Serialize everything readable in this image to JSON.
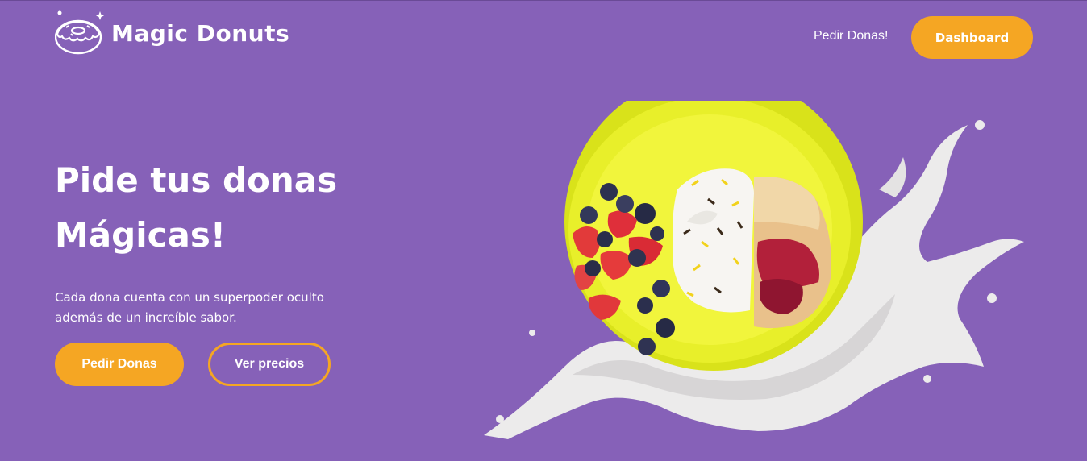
{
  "header": {
    "brand_name": "Magic Donuts",
    "logo_icon": "donut-logo-icon",
    "nav_link_label": "Pedir Donas!",
    "dashboard_label": "Dashboard"
  },
  "hero": {
    "title_line1": "Pide tus donas",
    "title_line2": "Mágicas!",
    "subtitle_line1": "Cada dona cuenta con un superpoder oculto",
    "subtitle_line2": "además de un increíble sabor.",
    "primary_button_label": "Pedir Donas",
    "secondary_button_label": "Ver precios",
    "image": "donut-plate-milk-splash"
  },
  "colors": {
    "background": "#8661b8",
    "accent": "#f5a623",
    "text": "#ffffff"
  }
}
